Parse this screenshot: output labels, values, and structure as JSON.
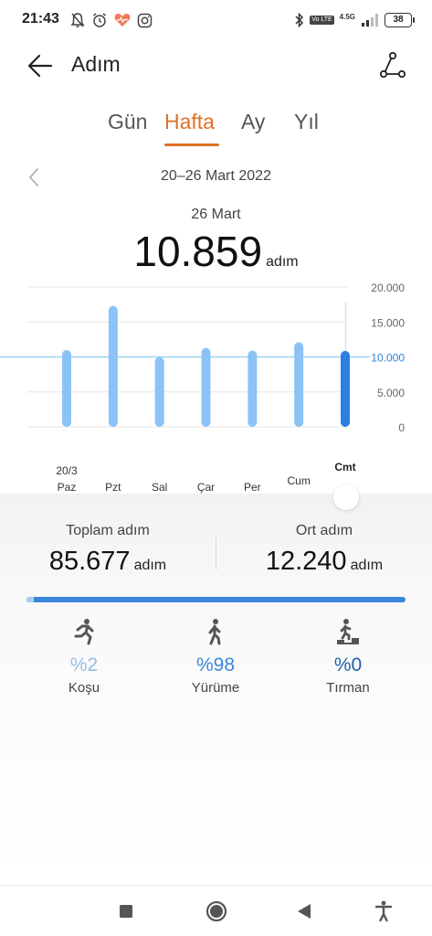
{
  "status_bar": {
    "time": "21:43",
    "icons": [
      "bell-off-icon",
      "alarm-icon",
      "health-heart-icon",
      "instagram-icon"
    ],
    "right_icons": [
      "bluetooth-icon",
      "volte-icon",
      "signal-icon"
    ],
    "volte_label": "Vo LTE",
    "network_label": "4.5G",
    "battery": "38"
  },
  "header": {
    "title": "Adım",
    "back_icon": "back-arrow-icon",
    "share_icon": "share-nodes-icon"
  },
  "tabs": [
    {
      "label": "Gün",
      "active": false
    },
    {
      "label": "Hafta",
      "active": true
    },
    {
      "label": "Ay",
      "active": false
    },
    {
      "label": "Yıl",
      "active": false
    }
  ],
  "period": {
    "label": "20–26 Mart 2022",
    "prev_icon": "chevron-left-icon"
  },
  "selected": {
    "date": "26 Mart",
    "value": "10.859",
    "unit": "adım"
  },
  "chart_data": {
    "type": "bar",
    "categories": [
      {
        "top": "20/3",
        "bottom": "Paz"
      },
      {
        "top": "",
        "bottom": "Pzt"
      },
      {
        "top": "",
        "bottom": "Sal"
      },
      {
        "top": "",
        "bottom": "Çar"
      },
      {
        "top": "",
        "bottom": "Per"
      },
      {
        "top": "",
        "bottom": "Cum"
      },
      {
        "top": "",
        "bottom": "Cmt"
      }
    ],
    "values": [
      11000,
      17300,
      10000,
      11300,
      10900,
      12100,
      10859
    ],
    "selected_index": 6,
    "y_ticks": [
      "20.000",
      "15.000",
      "10.000",
      "5.000",
      "0"
    ],
    "y_tick_values": [
      20000,
      15000,
      10000,
      5000,
      0
    ],
    "ylim": [
      0,
      20000
    ],
    "goal_line": 10000,
    "grid": true,
    "colors": {
      "bar": "#8cc3f7",
      "bar_selected": "#2b7fe3",
      "goal": "#9fd3f0",
      "goal_label": "#2b85d6",
      "grid": "#e6e6e6"
    }
  },
  "summary": {
    "total_label": "Toplam adım",
    "total_value": "85.677",
    "total_unit": "adım",
    "avg_label": "Ort adım",
    "avg_value": "12.240",
    "avg_unit": "adım"
  },
  "activity_progress": {
    "run_fraction": 0.02,
    "walk_fraction": 0.98,
    "colors": {
      "run": "#a9cdf2",
      "walk": "#3a86dd"
    }
  },
  "activities": [
    {
      "icon": "running-icon",
      "pct": "%2",
      "label": "Koşu",
      "color": "#93bfe8"
    },
    {
      "icon": "walking-icon",
      "pct": "%98",
      "label": "Yürüme",
      "color": "#3a86dd"
    },
    {
      "icon": "climbing-icon",
      "pct": "%0",
      "label": "Tırman",
      "color": "#2060a8"
    }
  ],
  "nav": [
    "recent-apps-icon",
    "home-icon",
    "back-triangle-icon",
    "accessibility-icon"
  ]
}
